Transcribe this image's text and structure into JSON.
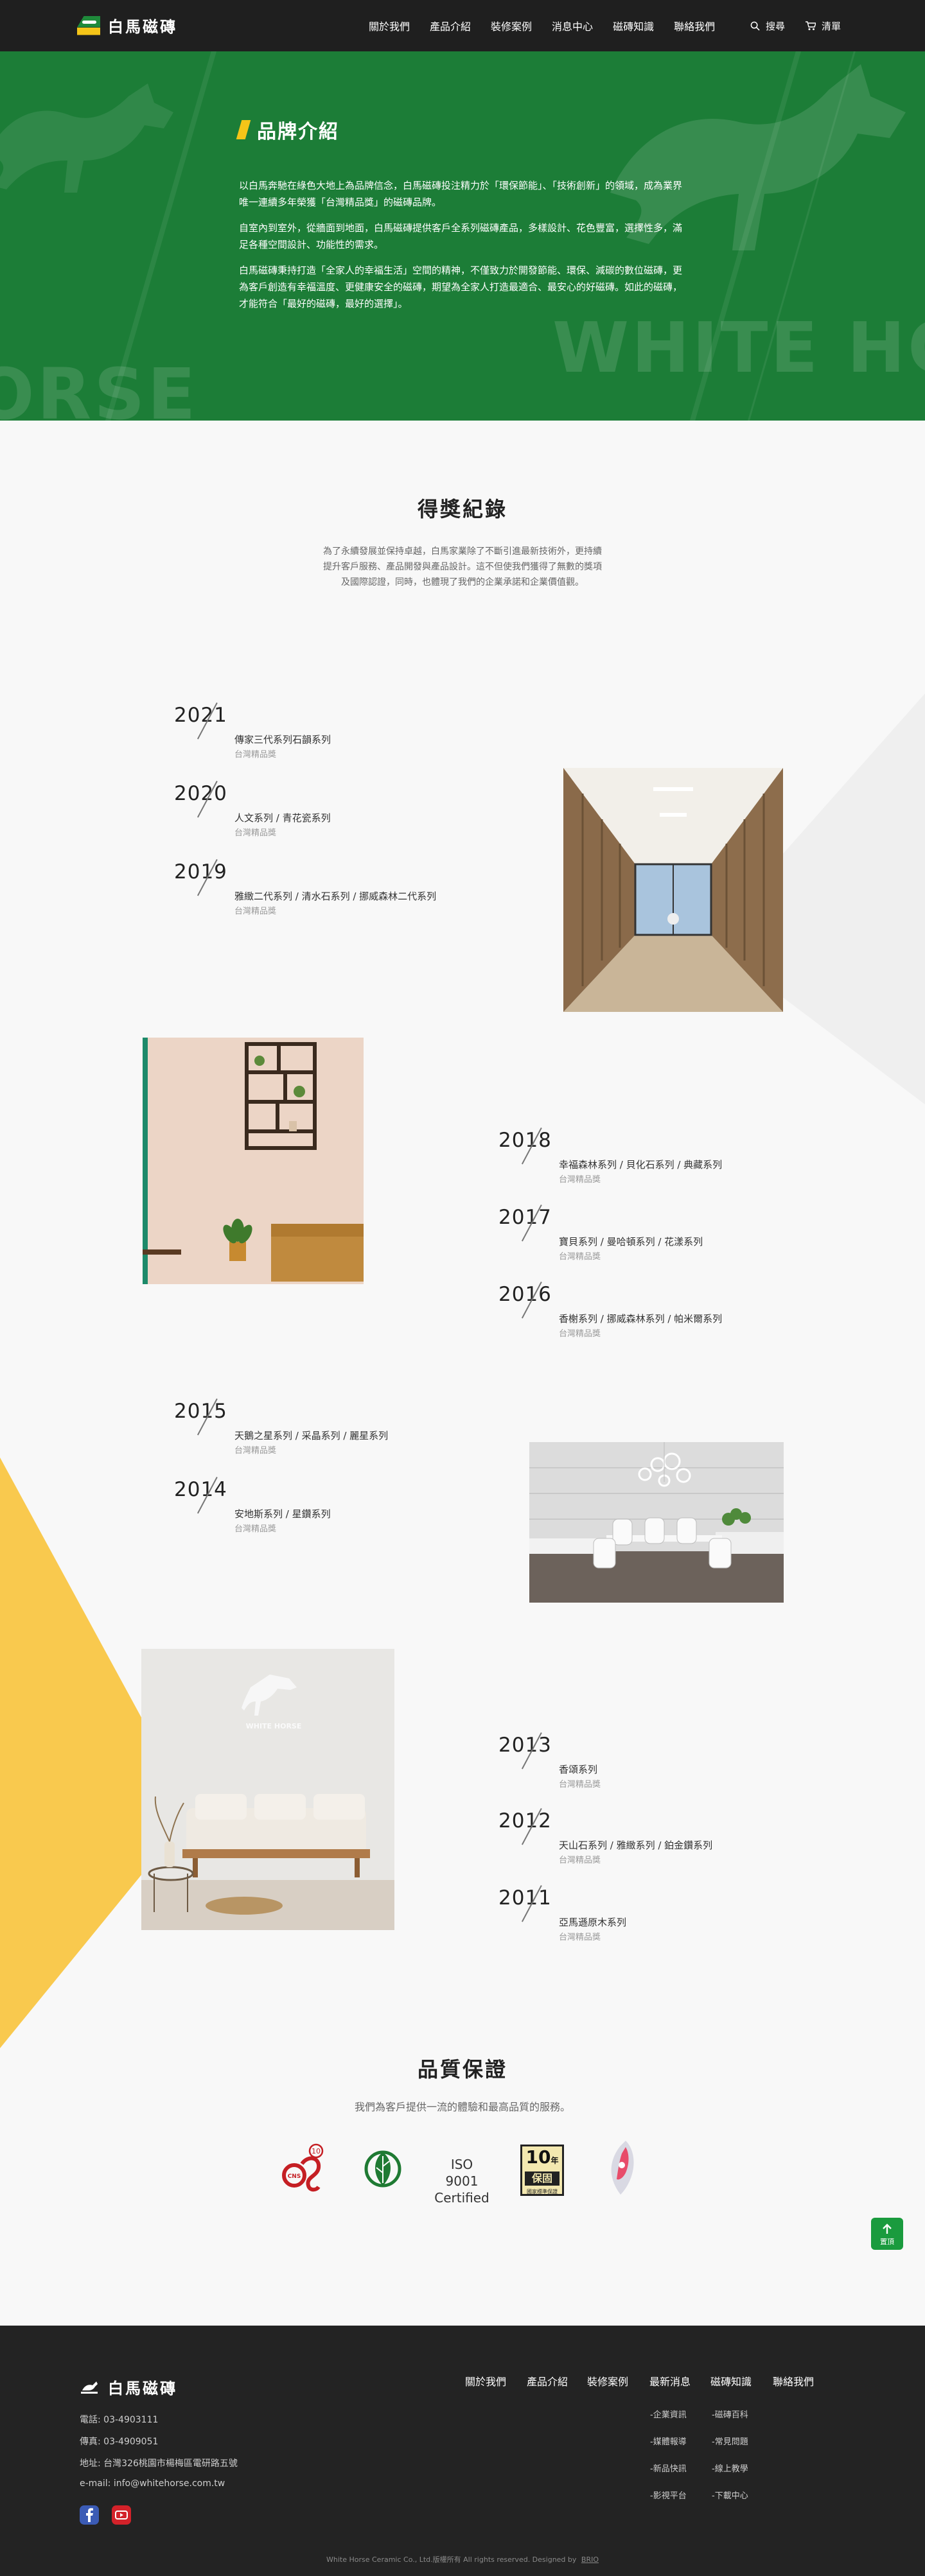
{
  "header": {
    "brand": "白馬磁磚",
    "nav": [
      "關於我們",
      "產品介紹",
      "裝修案例",
      "消息中心",
      "磁磚知識",
      "聯絡我們"
    ],
    "search_label": "搜尋",
    "cart_label": "清單"
  },
  "hero": {
    "title": "品牌介紹",
    "paragraphs": [
      "以白馬奔馳在綠色大地上為品牌信念，白馬磁磚投注精力於「環保節能」、「技術創新」的領域，成為業界唯一連續多年榮獲「台灣精品獎」的磁磚品牌。",
      "自室內到室外，從牆面到地面，白馬磁磚提供客戶全系列磁磚產品，多樣設計、花色豐富，選擇性多，滿足各種空間設計、功能性的需求。",
      "白馬磁磚秉持打造「全家人的幸福生活」空間的精神，不僅致力於開發節能、環保、減碳的數位磁磚，更為客戶創造有幸福溫度、更健康安全的磁磚，期望為全家人打造最適合、最安心的好磁磚。如此的磁磚，才能符合「最好的磁磚，最好的選擇」。"
    ],
    "watermark_left": "ORSE",
    "watermark_right": "WHITE HORSE"
  },
  "awards": {
    "title": "得獎紀錄",
    "intro": "為了永續發展並保持卓越，白馬家業除了不斷引進最新技術外，更持續提升客戶服務、產品開發與產品設計。這不但使我們獲得了無數的獎項及國際認證，同時，也體現了我們的企業承諾和企業價值觀。",
    "years": [
      {
        "year": "2021",
        "series": "傳家三代系列石韻系列",
        "label": "台灣精品獎"
      },
      {
        "year": "2020",
        "series": "人文系列 / 青花瓷系列",
        "label": "台灣精品獎"
      },
      {
        "year": "2019",
        "series": "雅緻二代系列 / 清水石系列 / 挪威森林二代系列",
        "label": "台灣精品獎"
      },
      {
        "year": "2018",
        "series": "幸福森林系列 / 貝化石系列 / 典藏系列",
        "label": "台灣精品獎"
      },
      {
        "year": "2017",
        "series": "寶貝系列 / 曼哈頓系列 / 花漾系列",
        "label": "台灣精品獎"
      },
      {
        "year": "2016",
        "series": "香榭系列 / 挪威森林系列 / 帕米爾系列",
        "label": "台灣精品獎"
      },
      {
        "year": "2015",
        "series": "天鵝之星系列 / 采晶系列 / 麗星系列",
        "label": "台灣精品獎"
      },
      {
        "year": "2014",
        "series": "安地斯系列 / 星鑽系列",
        "label": "台灣精品獎"
      },
      {
        "year": "2013",
        "series": "香頌系列",
        "label": "台灣精品獎"
      },
      {
        "year": "2012",
        "series": "天山石系列 / 雅緻系列 / 鉑金鑽系列",
        "label": "台灣精品獎"
      },
      {
        "year": "2011",
        "series": "亞馬遜原木系列",
        "label": "台灣精品獎"
      }
    ],
    "wall_logo": "WHITE HORSE"
  },
  "quality": {
    "title": "品質保證",
    "subtitle": "我們為客戶提供一流的體驗和最高品質的服務。",
    "iso_line1": "ISO 9001",
    "iso_line2": "Certified",
    "warranty_number": "10",
    "warranty_year_char": "年",
    "warranty_main": "保固",
    "warranty_sub": "國家標準保證",
    "cns_mark": "CNS",
    "badge_number": "10"
  },
  "top_button": {
    "label": "置頂"
  },
  "footer": {
    "brand": "白馬磁磚",
    "phone": "電話:  03-4903111",
    "fax": "傳真:  03-4909051",
    "address": "地址:  台灣326桃園市楊梅區電研路五號",
    "email": "e-mail:  info@whitehorse.com.tw",
    "nav": [
      "關於我們",
      "產品介紹",
      "裝修案例",
      "最新消息",
      "磁磚知識",
      "聯絡我們"
    ],
    "news_sub": [
      "-企業資訊",
      "-媒體報導",
      "-新品快訊",
      "-影視平台"
    ],
    "knowledge_sub": [
      "-磁磚百科",
      "-常見問題",
      "-線上教學",
      "-下載中心"
    ],
    "copyright": "White Horse Ceramic Co., Ltd.版權所有 All rights reserved. Designed by",
    "designer": "BRIO"
  },
  "colors": {
    "brand_green": "#1c7d37",
    "accent_yellow": "#f5c518",
    "header_bg": "#1f1f1f",
    "footer_bg": "#232323"
  }
}
